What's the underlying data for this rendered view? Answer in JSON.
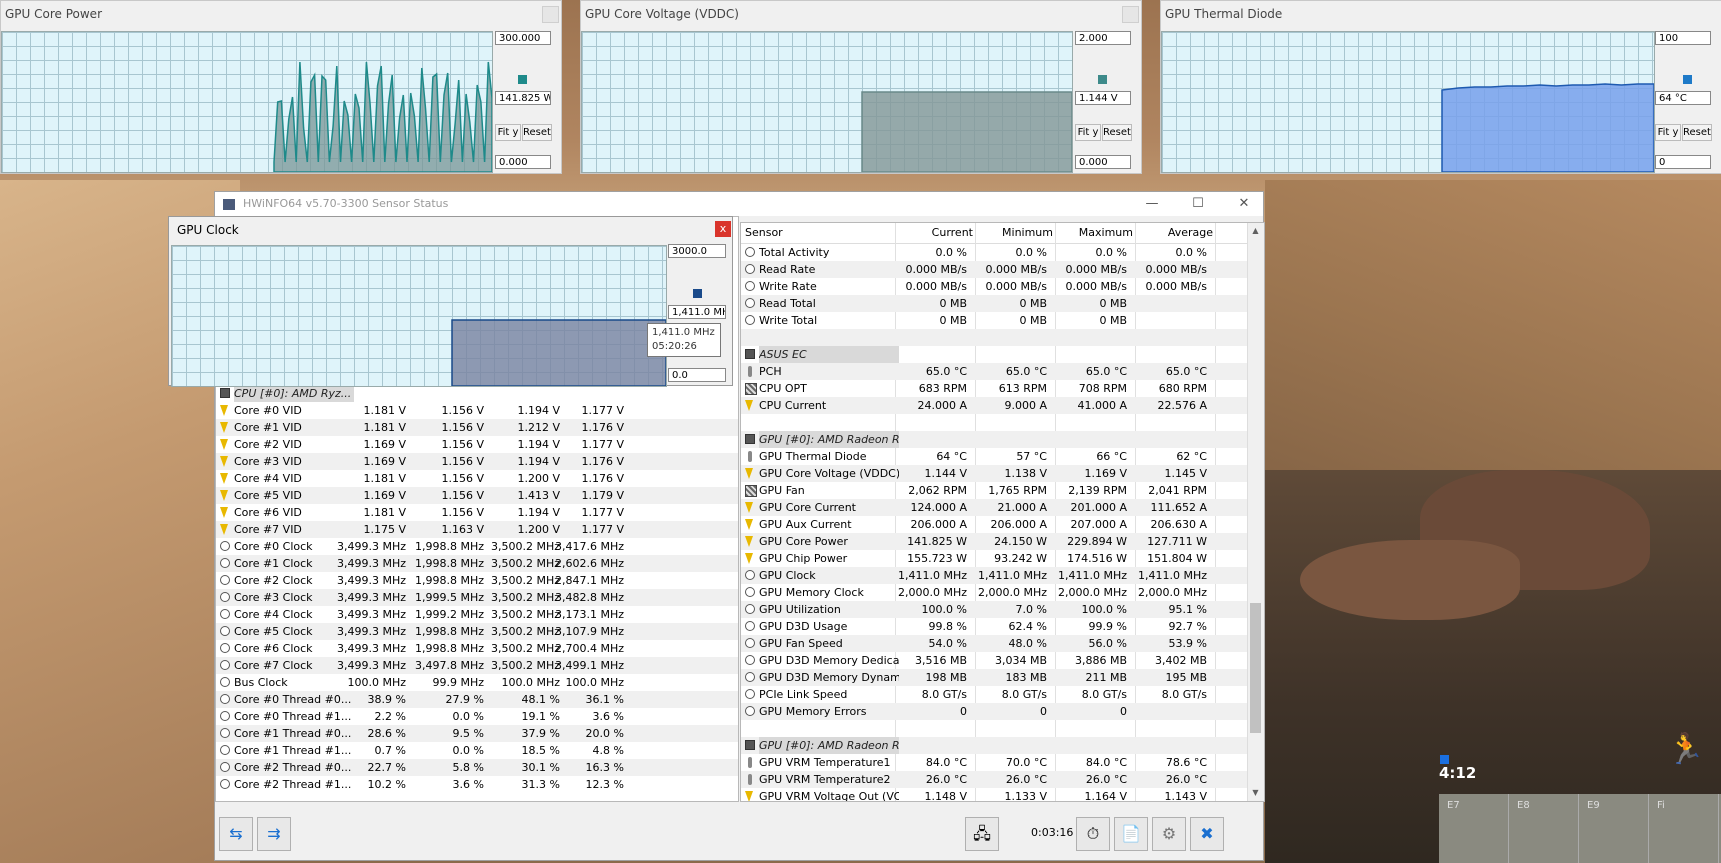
{
  "graphs": [
    {
      "title": "GPU Core Power",
      "max": "300.000",
      "current": "141.825 W",
      "min": "0.000",
      "fit": "Fit y",
      "reset": "Reset",
      "color": "#1e8a8a"
    },
    {
      "title": "GPU Core Voltage (VDDC)",
      "max": "2.000",
      "current": "1.144 V",
      "min": "0.000",
      "fit": "Fit y",
      "reset": "Reset",
      "color": "#3d8a8a"
    },
    {
      "title": "GPU Thermal Diode",
      "max": "100",
      "current": "64 °C",
      "min": "0",
      "fit": "Fit y",
      "reset": "Reset",
      "color": "#1e7ac8"
    }
  ],
  "gpu_clock": {
    "title": "GPU Clock",
    "max": "3000.0",
    "current": "1,411.0 MH;",
    "min": "0.0",
    "tooltip_value": "1,411.0 MHz",
    "tooltip_time": "05:20:26",
    "close": "x"
  },
  "window": {
    "title": "HWiNFO64 v5.70-3300 Sensor Status",
    "minimize": "—",
    "maximize": "☐",
    "close": "✕"
  },
  "left_pane": {
    "group": "CPU [#0]: AMD Ryz...",
    "rows": [
      {
        "icon": "bolt",
        "name": "Core #0 VID",
        "cur": "1.181 V",
        "min": "1.156 V",
        "max": "1.194 V",
        "avg": "1.177 V"
      },
      {
        "icon": "bolt",
        "name": "Core #1 VID",
        "cur": "1.181 V",
        "min": "1.156 V",
        "max": "1.212 V",
        "avg": "1.176 V"
      },
      {
        "icon": "bolt",
        "name": "Core #2 VID",
        "cur": "1.169 V",
        "min": "1.156 V",
        "max": "1.194 V",
        "avg": "1.177 V"
      },
      {
        "icon": "bolt",
        "name": "Core #3 VID",
        "cur": "1.169 V",
        "min": "1.156 V",
        "max": "1.194 V",
        "avg": "1.176 V"
      },
      {
        "icon": "bolt",
        "name": "Core #4 VID",
        "cur": "1.181 V",
        "min": "1.156 V",
        "max": "1.200 V",
        "avg": "1.176 V"
      },
      {
        "icon": "bolt",
        "name": "Core #5 VID",
        "cur": "1.169 V",
        "min": "1.156 V",
        "max": "1.413 V",
        "avg": "1.179 V"
      },
      {
        "icon": "bolt",
        "name": "Core #6 VID",
        "cur": "1.181 V",
        "min": "1.156 V",
        "max": "1.194 V",
        "avg": "1.177 V"
      },
      {
        "icon": "bolt",
        "name": "Core #7 VID",
        "cur": "1.175 V",
        "min": "1.163 V",
        "max": "1.200 V",
        "avg": "1.177 V"
      },
      {
        "icon": "clock",
        "name": "Core #0 Clock",
        "cur": "3,499.3 MHz",
        "min": "1,998.8 MHz",
        "max": "3,500.2 MHz",
        "avg": "3,417.6 MHz"
      },
      {
        "icon": "clock",
        "name": "Core #1 Clock",
        "cur": "3,499.3 MHz",
        "min": "1,998.8 MHz",
        "max": "3,500.2 MHz",
        "avg": "2,602.6 MHz"
      },
      {
        "icon": "clock",
        "name": "Core #2 Clock",
        "cur": "3,499.3 MHz",
        "min": "1,998.8 MHz",
        "max": "3,500.2 MHz",
        "avg": "2,847.1 MHz"
      },
      {
        "icon": "clock",
        "name": "Core #3 Clock",
        "cur": "3,499.3 MHz",
        "min": "1,999.5 MHz",
        "max": "3,500.2 MHz",
        "avg": "3,482.8 MHz"
      },
      {
        "icon": "clock",
        "name": "Core #4 Clock",
        "cur": "3,499.3 MHz",
        "min": "1,999.2 MHz",
        "max": "3,500.2 MHz",
        "avg": "3,173.1 MHz"
      },
      {
        "icon": "clock",
        "name": "Core #5 Clock",
        "cur": "3,499.3 MHz",
        "min": "1,998.8 MHz",
        "max": "3,500.2 MHz",
        "avg": "3,107.9 MHz"
      },
      {
        "icon": "clock",
        "name": "Core #6 Clock",
        "cur": "3,499.3 MHz",
        "min": "1,998.8 MHz",
        "max": "3,500.2 MHz",
        "avg": "2,700.4 MHz"
      },
      {
        "icon": "clock",
        "name": "Core #7 Clock",
        "cur": "3,499.3 MHz",
        "min": "3,497.8 MHz",
        "max": "3,500.2 MHz",
        "avg": "3,499.1 MHz"
      },
      {
        "icon": "clock",
        "name": "Bus Clock",
        "cur": "100.0 MHz",
        "min": "99.9 MHz",
        "max": "100.0 MHz",
        "avg": "100.0 MHz"
      },
      {
        "icon": "clock",
        "name": "Core #0 Thread #0...",
        "cur": "38.9 %",
        "min": "27.9 %",
        "max": "48.1 %",
        "avg": "36.1 %"
      },
      {
        "icon": "clock",
        "name": "Core #0 Thread #1...",
        "cur": "2.2 %",
        "min": "0.0 %",
        "max": "19.1 %",
        "avg": "3.6 %"
      },
      {
        "icon": "clock",
        "name": "Core #1 Thread #0...",
        "cur": "28.6 %",
        "min": "9.5 %",
        "max": "37.9 %",
        "avg": "20.0 %"
      },
      {
        "icon": "clock",
        "name": "Core #1 Thread #1...",
        "cur": "0.7 %",
        "min": "0.0 %",
        "max": "18.5 %",
        "avg": "4.8 %"
      },
      {
        "icon": "clock",
        "name": "Core #2 Thread #0...",
        "cur": "22.7 %",
        "min": "5.8 %",
        "max": "30.1 %",
        "avg": "16.3 %"
      },
      {
        "icon": "clock",
        "name": "Core #2 Thread #1...",
        "cur": "10.2 %",
        "min": "3.6 %",
        "max": "31.3 %",
        "avg": "12.3 %"
      }
    ]
  },
  "right_pane": {
    "headers": {
      "sensor": "Sensor",
      "current": "Current",
      "minimum": "Minimum",
      "maximum": "Maximum",
      "average": "Average"
    },
    "rows": [
      {
        "icon": "clock",
        "name": "Total Activity",
        "cur": "0.0 %",
        "min": "0.0 %",
        "max": "0.0 %",
        "avg": "0.0 %"
      },
      {
        "icon": "clock",
        "name": "Read Rate",
        "cur": "0.000 MB/s",
        "min": "0.000 MB/s",
        "max": "0.000 MB/s",
        "avg": "0.000 MB/s"
      },
      {
        "icon": "clock",
        "name": "Write Rate",
        "cur": "0.000 MB/s",
        "min": "0.000 MB/s",
        "max": "0.000 MB/s",
        "avg": "0.000 MB/s"
      },
      {
        "icon": "clock",
        "name": "Read Total",
        "cur": "0 MB",
        "min": "0 MB",
        "max": "0 MB",
        "avg": ""
      },
      {
        "icon": "clock",
        "name": "Write Total",
        "cur": "0 MB",
        "min": "0 MB",
        "max": "0 MB",
        "avg": ""
      },
      {
        "icon": "blank",
        "name": "",
        "cur": "",
        "min": "",
        "max": "",
        "avg": ""
      },
      {
        "icon": "chip",
        "name": "ASUS EC",
        "group": true
      },
      {
        "icon": "therm",
        "name": "PCH",
        "cur": "65.0 °C",
        "min": "65.0 °C",
        "max": "65.0 °C",
        "avg": "65.0 °C"
      },
      {
        "icon": "fan",
        "name": "CPU OPT",
        "cur": "683 RPM",
        "min": "613 RPM",
        "max": "708 RPM",
        "avg": "680 RPM"
      },
      {
        "icon": "bolt",
        "name": "CPU Current",
        "cur": "24.000 A",
        "min": "9.000 A",
        "max": "41.000 A",
        "avg": "22.576 A"
      },
      {
        "icon": "blank",
        "name": "",
        "cur": "",
        "min": "",
        "max": "",
        "avg": ""
      },
      {
        "icon": "chip",
        "name": "GPU [#0]: AMD Radeon RX...",
        "group": true
      },
      {
        "icon": "therm",
        "name": "GPU Thermal Diode",
        "cur": "64 °C",
        "min": "57 °C",
        "max": "66 °C",
        "avg": "62 °C"
      },
      {
        "icon": "bolt",
        "name": "GPU Core Voltage (VDDC)",
        "cur": "1.144 V",
        "min": "1.138 V",
        "max": "1.169 V",
        "avg": "1.145 V"
      },
      {
        "icon": "fan",
        "name": "GPU Fan",
        "cur": "2,062 RPM",
        "min": "1,765 RPM",
        "max": "2,139 RPM",
        "avg": "2,041 RPM"
      },
      {
        "icon": "bolt",
        "name": "GPU Core Current",
        "cur": "124.000 A",
        "min": "21.000 A",
        "max": "201.000 A",
        "avg": "111.652 A"
      },
      {
        "icon": "bolt",
        "name": "GPU Aux Current",
        "cur": "206.000 A",
        "min": "206.000 A",
        "max": "207.000 A",
        "avg": "206.630 A"
      },
      {
        "icon": "bolt",
        "name": "GPU Core Power",
        "cur": "141.825 W",
        "min": "24.150 W",
        "max": "229.894 W",
        "avg": "127.711 W"
      },
      {
        "icon": "bolt",
        "name": "GPU Chip Power",
        "cur": "155.723 W",
        "min": "93.242 W",
        "max": "174.516 W",
        "avg": "151.804 W"
      },
      {
        "icon": "clock",
        "name": "GPU Clock",
        "cur": "1,411.0 MHz",
        "min": "1,411.0 MHz",
        "max": "1,411.0 MHz",
        "avg": "1,411.0 MHz"
      },
      {
        "icon": "clock",
        "name": "GPU Memory Clock",
        "cur": "2,000.0 MHz",
        "min": "2,000.0 MHz",
        "max": "2,000.0 MHz",
        "avg": "2,000.0 MHz"
      },
      {
        "icon": "clock",
        "name": "GPU Utilization",
        "cur": "100.0 %",
        "min": "7.0 %",
        "max": "100.0 %",
        "avg": "95.1 %"
      },
      {
        "icon": "clock",
        "name": "GPU D3D Usage",
        "cur": "99.8 %",
        "min": "62.4 %",
        "max": "99.9 %",
        "avg": "92.7 %"
      },
      {
        "icon": "clock",
        "name": "GPU Fan Speed",
        "cur": "54.0 %",
        "min": "48.0 %",
        "max": "56.0 %",
        "avg": "53.9 %"
      },
      {
        "icon": "clock",
        "name": "GPU D3D Memory Dedicated",
        "cur": "3,516 MB",
        "min": "3,034 MB",
        "max": "3,886 MB",
        "avg": "3,402 MB"
      },
      {
        "icon": "clock",
        "name": "GPU D3D Memory Dynamic",
        "cur": "198 MB",
        "min": "183 MB",
        "max": "211 MB",
        "avg": "195 MB"
      },
      {
        "icon": "clock",
        "name": "PCIe Link Speed",
        "cur": "8.0 GT/s",
        "min": "8.0 GT/s",
        "max": "8.0 GT/s",
        "avg": "8.0 GT/s"
      },
      {
        "icon": "clock",
        "name": "GPU Memory Errors",
        "cur": "0",
        "min": "0",
        "max": "0",
        "avg": ""
      },
      {
        "icon": "blank",
        "name": "",
        "cur": "",
        "min": "",
        "max": "",
        "avg": ""
      },
      {
        "icon": "chip",
        "name": "GPU [#0]: AMD Radeon RX...",
        "group": true
      },
      {
        "icon": "therm",
        "name": "GPU VRM Temperature1",
        "cur": "84.0 °C",
        "min": "70.0 °C",
        "max": "84.0 °C",
        "avg": "78.6 °C"
      },
      {
        "icon": "therm",
        "name": "GPU VRM Temperature2",
        "cur": "26.0 °C",
        "min": "26.0 °C",
        "max": "26.0 °C",
        "avg": "26.0 °C"
      },
      {
        "icon": "bolt",
        "name": "GPU VRM Voltage Out (VOU...",
        "cur": "1.148 V",
        "min": "1.133 V",
        "max": "1.164 V",
        "avg": "1.143 V"
      }
    ]
  },
  "toolbar": {
    "elapsed": "0:03:16"
  },
  "hud": {
    "timer": "4:12",
    "grid": [
      "E7",
      "E8",
      "E9",
      "Fi"
    ]
  }
}
